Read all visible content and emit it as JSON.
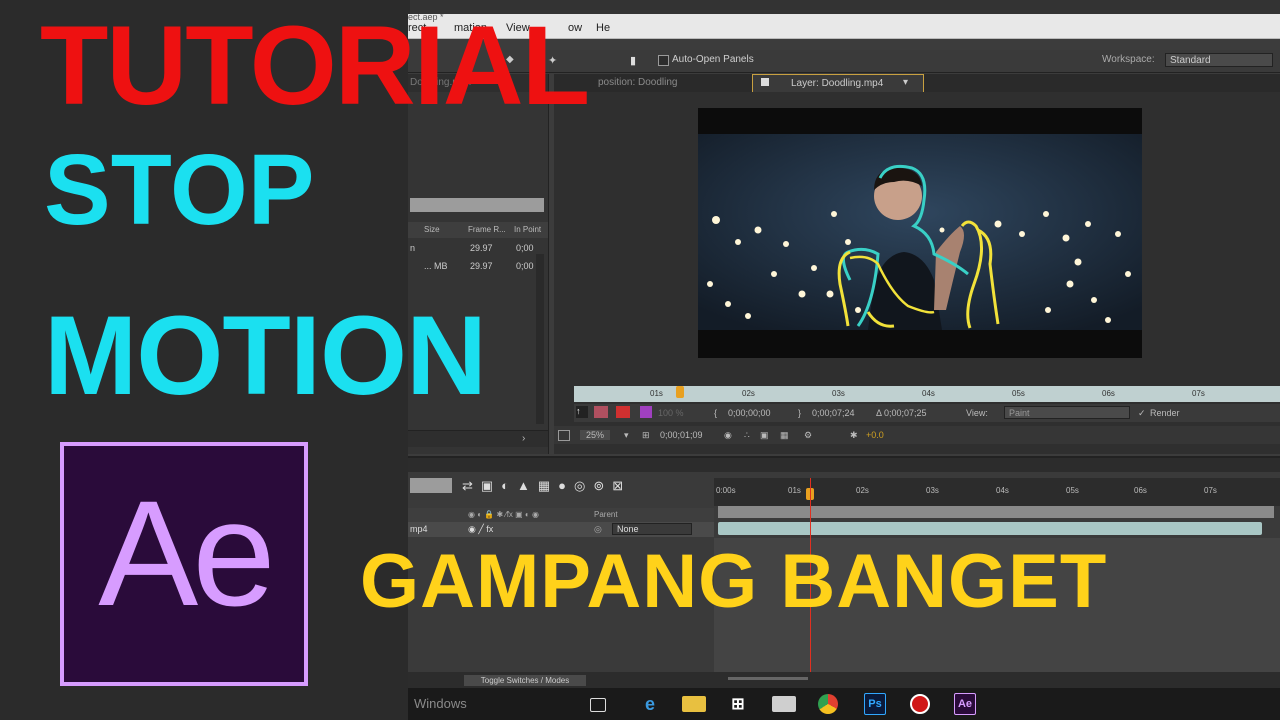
{
  "overlay": {
    "line1": "TUTORIAL",
    "line2": "STOP",
    "line3": "MOTION",
    "tagline": "GAMPANG BANGET",
    "logo_text": "Ae"
  },
  "colors": {
    "red": "#ee1111",
    "cyan": "#1be0f0",
    "yellow": "#ffd21a",
    "ae_purple": "#d79cff",
    "ae_dark": "#2a0b3a"
  },
  "ae": {
    "titlebar_text": "ect.aep *",
    "menu": [
      "rect",
      "mation",
      "View",
      "ow",
      "He"
    ],
    "toolbar": {
      "auto_open_label": "Auto-Open Panels",
      "workspace_label": "Workspace:",
      "workspace_value": "Standard"
    },
    "project": {
      "tab": "Doodling.mp4",
      "columns": [
        "Size",
        "Frame R...",
        "In Point"
      ],
      "rows": [
        {
          "name": "n",
          "size": "",
          "fps": "29.97",
          "in": "0;00"
        },
        {
          "name": "",
          "size": "... MB",
          "fps": "29.97",
          "in": "0;00"
        }
      ]
    },
    "comp": {
      "tab_comp": "position: Doodling",
      "tab_layer": "Layer: Doodling.mp4",
      "ruler": [
        "01s",
        "02s",
        "03s",
        "04s",
        "05s",
        "06s",
        "07s"
      ],
      "zoom_pct": "100 %",
      "time_in": "0;00;00;00",
      "time_out": "0;00;07;24",
      "duration": "Δ 0;00;07;25",
      "view_label": "View:",
      "view_value": "Paint",
      "render_label": "Render",
      "mag": "25%",
      "current_time": "0;00;01;09",
      "exposure": "+0.0"
    },
    "timeline": {
      "ruler": [
        "0:00s",
        "01s",
        "02s",
        "03s",
        "04s",
        "05s",
        "06s",
        "07s"
      ],
      "parent_header": "Parent",
      "layer_name": "mp4",
      "parent_value": "None",
      "toggle_label": "Toggle Switches / Modes"
    }
  },
  "taskbar": {
    "watermark": "Windows",
    "icons": [
      "task-view",
      "edge",
      "file-explorer",
      "store",
      "photos",
      "chrome",
      "photoshop",
      "recorder",
      "after-effects"
    ]
  }
}
